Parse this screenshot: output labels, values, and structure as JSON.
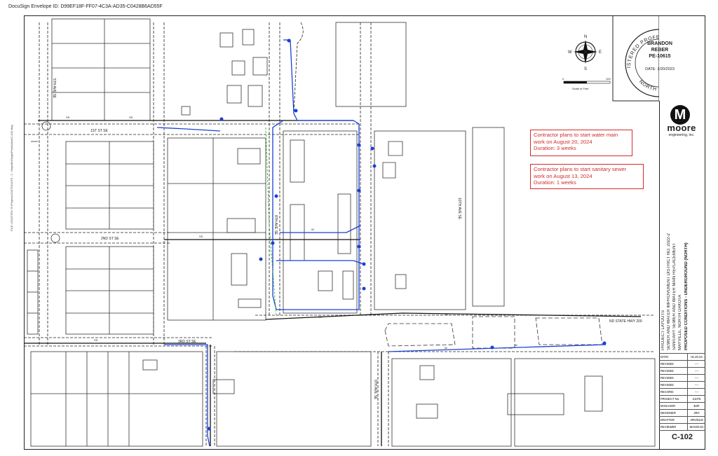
{
  "envelope_id": "DocuSign Envelope ID: D99EF18F-FF07-4C3A-AD35-C0428B6AD55F",
  "side_file_location": "FILE LOCATION: R:\\Projects\\21075\\21075 - 2 - Mayville\\Dwgs\\Production\\C-102.dwg",
  "notes": {
    "water": {
      "line1": "Contractor plans to start water main",
      "line2": "work on August 20, 2024",
      "line3": "Duration: 3 weeks"
    },
    "sewer": {
      "line1": "Contractor plans to start sanitary sewer",
      "line2": "work on August 13, 2024",
      "line3": "Duration: 1 weeks"
    }
  },
  "compass": {
    "n": "N",
    "s": "S",
    "e": "E",
    "w": "W"
  },
  "scale": {
    "zero": "0",
    "max": "100",
    "label": "Scale in Feet"
  },
  "stamp": {
    "ring_top": "REGISTERED PROFESSIONAL ENGINEER",
    "ring_bottom": "NORTH DAKOTA",
    "name_first": "BRANDON",
    "name_last": "REBER",
    "license": "PE-10615",
    "date": "DATE: 1/20/2023"
  },
  "logo": {
    "mark": "M",
    "name": "moore",
    "sub": "engineering, inc."
  },
  "title_block": {
    "line1": "PROJECT LAYOUTS",
    "line2": "SEWER AND WATER IMPROVEMENT DISTRICT NO. 2022-2",
    "line3": "SANITARY SEWER AND WATER MAIN REPLACEMENT",
    "line4": "MAYVILLE, NORTH DAKOTA",
    "line5": "PROPOSED CONDITIONS - UNDERGROUND (NORTH)"
  },
  "revisions": [
    {
      "k": "DATE:",
      "v": "01.20.23"
    },
    {
      "k": "REVISED:",
      "v": "----"
    },
    {
      "k": "REVISED:",
      "v": "----"
    },
    {
      "k": "REVISED:",
      "v": "----"
    },
    {
      "k": "REVISED:",
      "v": "----"
    },
    {
      "k": "RECORD:",
      "v": "----"
    },
    {
      "k": "PROJECT No.",
      "v": "21075"
    },
    {
      "k": "MANAGER",
      "v": "BJR"
    },
    {
      "k": "DESIGNER",
      "v": "JRH"
    },
    {
      "k": "DRAFTER",
      "v": "JRH/DLM"
    },
    {
      "k": "REVIEWER",
      "v": "MAG/DAG"
    }
  ],
  "sheet_number": "C-102",
  "streets": {
    "first_st": "1ST ST SE",
    "second_st": "2ND ST SE",
    "third_st": "3RD ST SE",
    "fifth_ave": "5TH AVE SE",
    "eighth_ave": "8TH AVE SE",
    "ninth_ave": "9TH AVE SE",
    "tenth_ave": "10TH AVE SE",
    "hwy": "ND STATE HWY 200"
  },
  "line_codes": {
    "sewer": "SS",
    "water": "W"
  },
  "colors": {
    "water_line": "#1a3fd6",
    "sewer_line": "#111111",
    "note": "#d42a2a",
    "grass": "#2fb52f"
  }
}
